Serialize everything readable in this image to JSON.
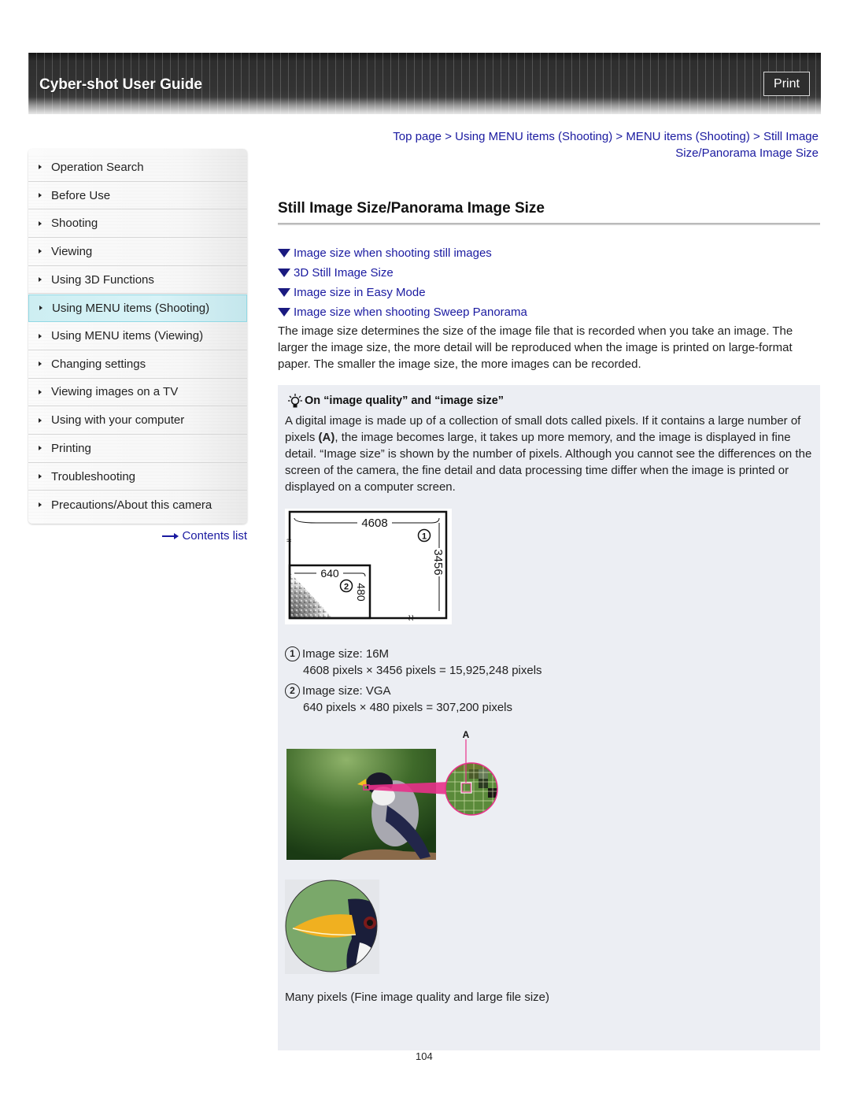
{
  "header": {
    "title": "Cyber-shot User Guide",
    "print_label": "Print"
  },
  "breadcrumb": {
    "items": [
      "Top page",
      "Using MENU items (Shooting)",
      "MENU items (Shooting)",
      "Still Image Size/Panorama Image Size"
    ],
    "separator": ">"
  },
  "sidebar": {
    "items": [
      {
        "label": "Operation Search",
        "active": false
      },
      {
        "label": "Before Use",
        "active": false
      },
      {
        "label": "Shooting",
        "active": false
      },
      {
        "label": "Viewing",
        "active": false
      },
      {
        "label": "Using 3D Functions",
        "active": false
      },
      {
        "label": "Using MENU items (Shooting)",
        "active": true
      },
      {
        "label": "Using MENU items (Viewing)",
        "active": false
      },
      {
        "label": "Changing settings",
        "active": false
      },
      {
        "label": "Viewing images on a TV",
        "active": false
      },
      {
        "label": "Using with your computer",
        "active": false
      },
      {
        "label": "Printing",
        "active": false
      },
      {
        "label": "Troubleshooting",
        "active": false
      },
      {
        "label": "Precautions/About this camera",
        "active": false
      }
    ],
    "contents_link": "Contents list"
  },
  "main": {
    "title": "Still Image Size/Panorama Image Size",
    "toc": [
      "Image size when shooting still images",
      "3D Still Image Size",
      "Image size in Easy Mode",
      "Image size when shooting Sweep Panorama"
    ],
    "intro": "The image size determines the size of the image file that is recorded when you take an image. The larger the image size, the more detail will be reproduced when the image is printed on large-format paper. The smaller the image size, the more images can be recorded.",
    "hint": {
      "title": "On “image quality” and “image size”",
      "text_before": "A digital image is made up of a collection of small dots called pixels. If it contains a large number of pixels ",
      "text_bold": "(A)",
      "text_after": ", the image becomes large, it takes up more memory, and the image is displayed in fine detail. “Image size” is shown by the number of pixels. Although you cannot see the differences on the screen of the camera, the fine detail and data processing time differ when the image is printed or displayed on a computer screen.",
      "diagram": {
        "large_width": "4608",
        "large_height": "3456",
        "small_width": "640",
        "small_height": "480",
        "marker_1": "1",
        "marker_2": "2"
      },
      "legend": [
        {
          "num": "1",
          "label": "Image size: 16M",
          "detail": "4608 pixels × 3456 pixels = 15,925,248 pixels"
        },
        {
          "num": "2",
          "label": "Image size: VGA",
          "detail": "640 pixels × 480 pixels = 307,200 pixels"
        }
      ],
      "figure_marker": "A",
      "caption": "Many pixels (Fine image quality and large file size)"
    }
  },
  "footer": {
    "page_number": "104"
  },
  "colors": {
    "link": "#1a1aa0",
    "active_nav": "#d8f3f7",
    "hint_bg": "#eceef3",
    "highlight_pink": "#e8308a"
  }
}
